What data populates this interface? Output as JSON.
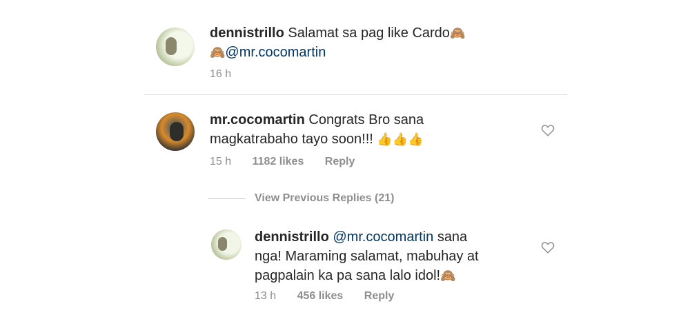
{
  "comment1": {
    "username": "dennistrillo",
    "text": "Salamat sa pag like Cardo",
    "mention": "@mr.cocomartin",
    "time": "16 h"
  },
  "comment2": {
    "username": "mr.cocomartin",
    "text": "Congrats Bro sana magkatrabaho tayo soon!!!",
    "time": "15 h",
    "likes": "1182 likes",
    "reply": "Reply"
  },
  "view_replies": "View Previous Replies (21)",
  "comment3": {
    "username": "dennistrillo",
    "mention": "@mr.cocomartin",
    "text_line1": "sana",
    "text_line2": "nga! Maraming salamat, mabuhay at",
    "text_line3": "pagpalain ka pa sana lalo idol!",
    "time": "13 h",
    "likes": "456 likes",
    "reply": "Reply"
  },
  "icons": {
    "heart": "heart-icon",
    "emoji": "emoji-icon",
    "thumbs_up": "thumbs-up-icon"
  }
}
